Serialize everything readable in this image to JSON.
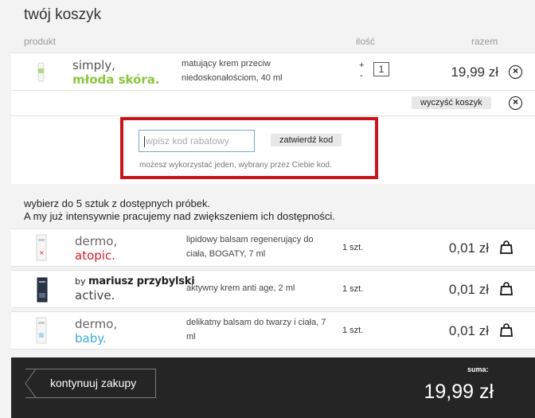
{
  "page_title": "twój koszyk",
  "columns": {
    "product": "produkt",
    "qty": "ilość",
    "total": "razem"
  },
  "cart_item": {
    "brand_line1": "simply,",
    "brand_line2": "młoda skóra.",
    "description": "matujący krem przeciw niedoskonałościom, 40 ml",
    "qty_plus": "+",
    "qty_minus": "-",
    "qty": "1",
    "price": "19,99 zł",
    "brand_colors": {
      "line1": "#555555",
      "line2": "#8cc63f"
    }
  },
  "clear_cart_label": "wyczyść koszyk",
  "coupon": {
    "placeholder": "wpisz kod rabatowy",
    "submit_label": "zatwierdź kod",
    "note": "możesz wykorzystać jeden, wybrany przez Ciebie kod.",
    "highlight_color": "#c8151b"
  },
  "samples_intro": {
    "line1": "wybierz do 5 sztuk z dostępnych próbek.",
    "line2": "A my już intensywnie pracujemy nad zwiększeniem ich dostępności."
  },
  "samples": [
    {
      "brand_line1": "dermo,",
      "brand_line2": "atopic.",
      "accent_color": "#d6202a",
      "description": "lipidowy balsam regenerujący do ciała, BOGATY, 7 ml",
      "qty": "1 szt.",
      "price": "0,01 zł"
    },
    {
      "brand_prefix": "by",
      "brand_line1": "mariusz przybylski",
      "brand_line2": "active.",
      "description": "aktywny krem anti age, 2 ml",
      "qty": "1 szt.",
      "price": "0,01 zł"
    },
    {
      "brand_line1": "dermo,",
      "brand_line2": "baby.",
      "accent_color": "#3fa9d9",
      "description": "delikatny balsam do twarzy i ciała, 7 ml",
      "qty": "1 szt.",
      "price": "0,01 zł"
    }
  ],
  "footer": {
    "continue_label": "kontynuuj zakupy",
    "sum_label": "suma:",
    "sum_value": "19,99 zł"
  },
  "icons": {
    "remove": "close-circle-icon",
    "cart_add": "shopping-bag-icon",
    "back": "chevron-left-icon"
  }
}
